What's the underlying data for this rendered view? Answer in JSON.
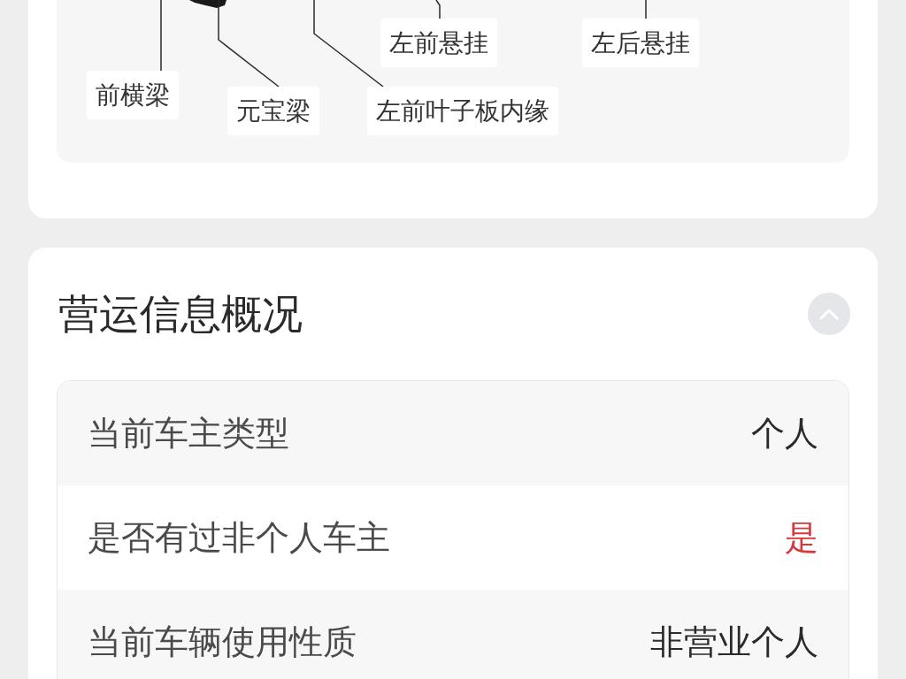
{
  "diagram": {
    "labels": [
      "左前悬挂",
      "左后悬挂",
      "前横梁",
      "元宝梁",
      "左前叶子板内缘"
    ]
  },
  "section": {
    "title": "营运信息概况",
    "expanded": true,
    "rows": [
      {
        "label": "当前车主类型",
        "value": "个人",
        "alert": false
      },
      {
        "label": "是否有过非个人车主",
        "value": "是",
        "alert": true
      },
      {
        "label": "当前车辆使用性质",
        "value": "非营业个人",
        "alert": false
      }
    ]
  }
}
